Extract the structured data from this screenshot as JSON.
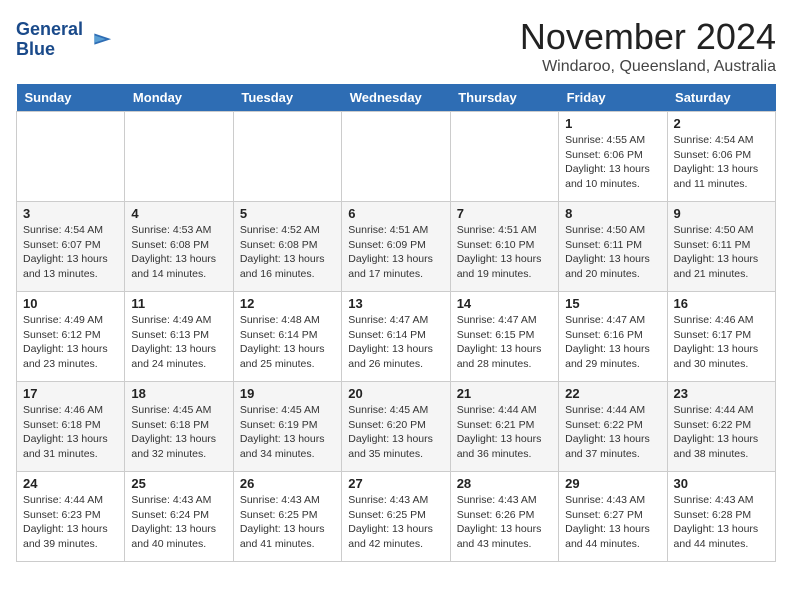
{
  "header": {
    "logo_line1": "General",
    "logo_line2": "Blue",
    "month": "November 2024",
    "location": "Windaroo, Queensland, Australia"
  },
  "days_of_week": [
    "Sunday",
    "Monday",
    "Tuesday",
    "Wednesday",
    "Thursday",
    "Friday",
    "Saturday"
  ],
  "weeks": [
    [
      {
        "day": "",
        "text": ""
      },
      {
        "day": "",
        "text": ""
      },
      {
        "day": "",
        "text": ""
      },
      {
        "day": "",
        "text": ""
      },
      {
        "day": "",
        "text": ""
      },
      {
        "day": "1",
        "text": "Sunrise: 4:55 AM\nSunset: 6:06 PM\nDaylight: 13 hours\nand 10 minutes."
      },
      {
        "day": "2",
        "text": "Sunrise: 4:54 AM\nSunset: 6:06 PM\nDaylight: 13 hours\nand 11 minutes."
      }
    ],
    [
      {
        "day": "3",
        "text": "Sunrise: 4:54 AM\nSunset: 6:07 PM\nDaylight: 13 hours\nand 13 minutes."
      },
      {
        "day": "4",
        "text": "Sunrise: 4:53 AM\nSunset: 6:08 PM\nDaylight: 13 hours\nand 14 minutes."
      },
      {
        "day": "5",
        "text": "Sunrise: 4:52 AM\nSunset: 6:08 PM\nDaylight: 13 hours\nand 16 minutes."
      },
      {
        "day": "6",
        "text": "Sunrise: 4:51 AM\nSunset: 6:09 PM\nDaylight: 13 hours\nand 17 minutes."
      },
      {
        "day": "7",
        "text": "Sunrise: 4:51 AM\nSunset: 6:10 PM\nDaylight: 13 hours\nand 19 minutes."
      },
      {
        "day": "8",
        "text": "Sunrise: 4:50 AM\nSunset: 6:11 PM\nDaylight: 13 hours\nand 20 minutes."
      },
      {
        "day": "9",
        "text": "Sunrise: 4:50 AM\nSunset: 6:11 PM\nDaylight: 13 hours\nand 21 minutes."
      }
    ],
    [
      {
        "day": "10",
        "text": "Sunrise: 4:49 AM\nSunset: 6:12 PM\nDaylight: 13 hours\nand 23 minutes."
      },
      {
        "day": "11",
        "text": "Sunrise: 4:49 AM\nSunset: 6:13 PM\nDaylight: 13 hours\nand 24 minutes."
      },
      {
        "day": "12",
        "text": "Sunrise: 4:48 AM\nSunset: 6:14 PM\nDaylight: 13 hours\nand 25 minutes."
      },
      {
        "day": "13",
        "text": "Sunrise: 4:47 AM\nSunset: 6:14 PM\nDaylight: 13 hours\nand 26 minutes."
      },
      {
        "day": "14",
        "text": "Sunrise: 4:47 AM\nSunset: 6:15 PM\nDaylight: 13 hours\nand 28 minutes."
      },
      {
        "day": "15",
        "text": "Sunrise: 4:47 AM\nSunset: 6:16 PM\nDaylight: 13 hours\nand 29 minutes."
      },
      {
        "day": "16",
        "text": "Sunrise: 4:46 AM\nSunset: 6:17 PM\nDaylight: 13 hours\nand 30 minutes."
      }
    ],
    [
      {
        "day": "17",
        "text": "Sunrise: 4:46 AM\nSunset: 6:18 PM\nDaylight: 13 hours\nand 31 minutes."
      },
      {
        "day": "18",
        "text": "Sunrise: 4:45 AM\nSunset: 6:18 PM\nDaylight: 13 hours\nand 32 minutes."
      },
      {
        "day": "19",
        "text": "Sunrise: 4:45 AM\nSunset: 6:19 PM\nDaylight: 13 hours\nand 34 minutes."
      },
      {
        "day": "20",
        "text": "Sunrise: 4:45 AM\nSunset: 6:20 PM\nDaylight: 13 hours\nand 35 minutes."
      },
      {
        "day": "21",
        "text": "Sunrise: 4:44 AM\nSunset: 6:21 PM\nDaylight: 13 hours\nand 36 minutes."
      },
      {
        "day": "22",
        "text": "Sunrise: 4:44 AM\nSunset: 6:22 PM\nDaylight: 13 hours\nand 37 minutes."
      },
      {
        "day": "23",
        "text": "Sunrise: 4:44 AM\nSunset: 6:22 PM\nDaylight: 13 hours\nand 38 minutes."
      }
    ],
    [
      {
        "day": "24",
        "text": "Sunrise: 4:44 AM\nSunset: 6:23 PM\nDaylight: 13 hours\nand 39 minutes."
      },
      {
        "day": "25",
        "text": "Sunrise: 4:43 AM\nSunset: 6:24 PM\nDaylight: 13 hours\nand 40 minutes."
      },
      {
        "day": "26",
        "text": "Sunrise: 4:43 AM\nSunset: 6:25 PM\nDaylight: 13 hours\nand 41 minutes."
      },
      {
        "day": "27",
        "text": "Sunrise: 4:43 AM\nSunset: 6:25 PM\nDaylight: 13 hours\nand 42 minutes."
      },
      {
        "day": "28",
        "text": "Sunrise: 4:43 AM\nSunset: 6:26 PM\nDaylight: 13 hours\nand 43 minutes."
      },
      {
        "day": "29",
        "text": "Sunrise: 4:43 AM\nSunset: 6:27 PM\nDaylight: 13 hours\nand 44 minutes."
      },
      {
        "day": "30",
        "text": "Sunrise: 4:43 AM\nSunset: 6:28 PM\nDaylight: 13 hours\nand 44 minutes."
      }
    ]
  ]
}
